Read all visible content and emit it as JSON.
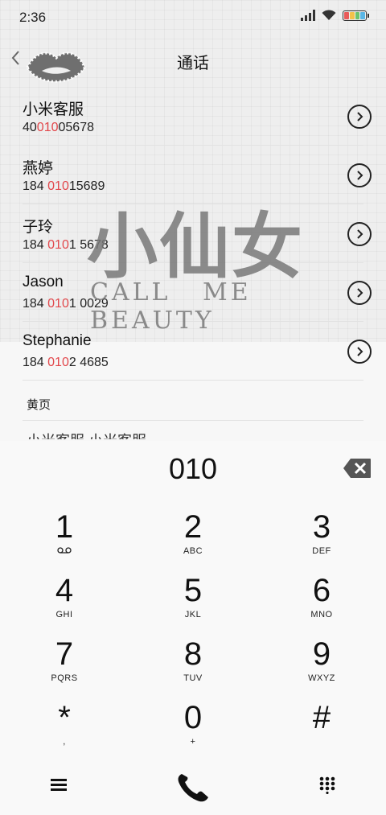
{
  "status_bar": {
    "time": "2:36"
  },
  "header": {
    "title": "通话"
  },
  "contacts": [
    {
      "name": "小米客服",
      "num_pre": "40",
      "num_hl": "010",
      "num_post": "05678"
    },
    {
      "name": "燕婷",
      "num_pre": "184 ",
      "num_hl": "010",
      "num_post": "15689"
    },
    {
      "name": "子玲",
      "num_pre": "184 ",
      "num_hl": "010",
      "num_post": "1 5678"
    },
    {
      "name": "Jason",
      "num_pre": "184 ",
      "num_hl": "010",
      "num_post": "1 0029"
    },
    {
      "name": "Stephanie",
      "num_pre": "184 ",
      "num_hl": "010",
      "num_post": "2 4685"
    }
  ],
  "yellow_pages": {
    "label": "黄页",
    "partial": "小米客服 小米客服"
  },
  "watermark": {
    "big": "小仙女",
    "small": "CALL ME BEAUTY"
  },
  "dialpad": {
    "input": "010",
    "keys": [
      {
        "digit": "1",
        "letters": ""
      },
      {
        "digit": "2",
        "letters": "ABC"
      },
      {
        "digit": "3",
        "letters": "DEF"
      },
      {
        "digit": "4",
        "letters": "GHI"
      },
      {
        "digit": "5",
        "letters": "JKL"
      },
      {
        "digit": "6",
        "letters": "MNO"
      },
      {
        "digit": "7",
        "letters": "PQRS"
      },
      {
        "digit": "8",
        "letters": "TUV"
      },
      {
        "digit": "9",
        "letters": "WXYZ"
      },
      {
        "digit": "*",
        "letters": ","
      },
      {
        "digit": "0",
        "letters": "+"
      },
      {
        "digit": "#",
        "letters": ""
      }
    ]
  },
  "icons": {
    "back": "chevron-left-icon",
    "more": "chevron-right-circle-icon",
    "backspace": "backspace-icon",
    "voicemail": "voicemail-icon",
    "menu": "menu-icon",
    "call": "phone-icon",
    "dialpad_toggle": "grid-icon"
  },
  "colors": {
    "highlight": "#e2474b"
  }
}
